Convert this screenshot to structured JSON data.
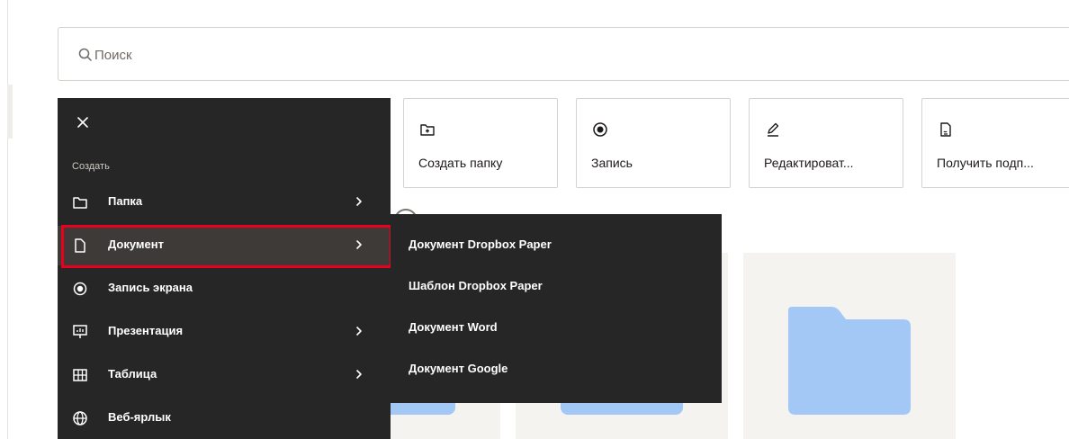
{
  "search": {
    "placeholder": "Поиск"
  },
  "quick_actions": [
    {
      "label": "Создать папку",
      "icon": "folder-plus-icon"
    },
    {
      "label": "Запись",
      "icon": "record-icon"
    },
    {
      "label": "Редактироват...",
      "icon": "pencil-icon"
    },
    {
      "label": "Получить подп...",
      "icon": "signature-doc-icon"
    }
  ],
  "create_menu": {
    "heading": "Создать",
    "items": [
      {
        "label": "Папка",
        "icon": "folder-icon",
        "has_submenu": true
      },
      {
        "label": "Документ",
        "icon": "document-icon",
        "has_submenu": true,
        "active": true
      },
      {
        "label": "Запись экрана",
        "icon": "record-icon",
        "has_submenu": false
      },
      {
        "label": "Презентация",
        "icon": "presentation-icon",
        "has_submenu": true
      },
      {
        "label": "Таблица",
        "icon": "table-icon",
        "has_submenu": true
      },
      {
        "label": "Веб-ярлык",
        "icon": "globe-icon",
        "has_submenu": false
      }
    ]
  },
  "document_submenu": {
    "items": [
      {
        "label": "Документ Dropbox Paper"
      },
      {
        "label": "Шаблон Dropbox Paper"
      },
      {
        "label": "Документ Word"
      },
      {
        "label": "Документ Google"
      }
    ]
  },
  "colors": {
    "menu_bg": "#262626",
    "highlight": "#e8001c",
    "folder_blue": "#a3c8f5",
    "tile_bg": "#f5f3ef"
  }
}
